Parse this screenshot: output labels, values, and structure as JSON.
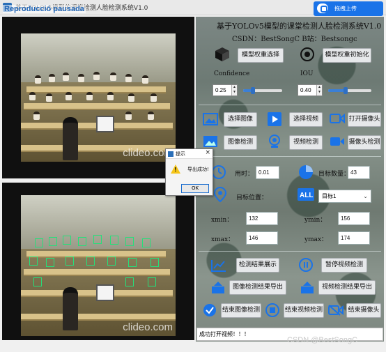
{
  "window": {
    "title": "基于YOLOv5模型的课堂检测人脸检测系统V1.0"
  },
  "overlay": {
    "recording_tag": "Reproducció pausada"
  },
  "upload_badge": {
    "label": "拖拽上传"
  },
  "right_panel": {
    "title": "基于YOLOv5模型的课堂检测人脸检测系统V1.0",
    "subtitle": "CSDN：BestSongC  B站：Bestsongc",
    "buttons": {
      "model_select": "模型权重选择",
      "model_init": "模型权重初始化",
      "select_image": "选择图像",
      "select_video": "选择视频",
      "open_camera": "打开摄像头",
      "image_detect": "图像检测",
      "video_detect": "视频检测",
      "camera_detect": "摄像头检测",
      "show_result": "检测结果展示",
      "pause_video": "暂停视频检测",
      "export_image": "图像检测结果导出",
      "export_video": "视频检测结果导出",
      "end_image": "结束图像检测",
      "end_video": "结束视频检测",
      "end_camera": "结束摄像头"
    },
    "confidence": {
      "label": "Confidence",
      "value": "0.25",
      "level": 0.25
    },
    "iou": {
      "label": "IOU",
      "value": "0.40",
      "level": 0.4
    },
    "time": {
      "label": "用时：",
      "value": "0.01"
    },
    "target_count": {
      "label": "目标数量：",
      "value": "43"
    },
    "target_pos": {
      "label": "目标位置："
    },
    "target_select": {
      "value": "目标1"
    },
    "coords": {
      "xmin_label": "xmin：",
      "xmin": "132",
      "ymin_label": "ymin：",
      "ymin": "156",
      "xmax_label": "xmax：",
      "xmax": "146",
      "ymax_label": "ymax：",
      "ymax": "174"
    },
    "status": "成功打开视频！！！"
  },
  "videos": {
    "watermark": "clideo.com"
  },
  "dialog": {
    "title": "提示",
    "message": "导出成功!",
    "ok": "OK"
  },
  "footer": {
    "watermark": "CSDN @BestSongC"
  },
  "colors": {
    "accent": "#1a73e8",
    "detect_box": "#25e07a",
    "warning": "#f5c518"
  }
}
